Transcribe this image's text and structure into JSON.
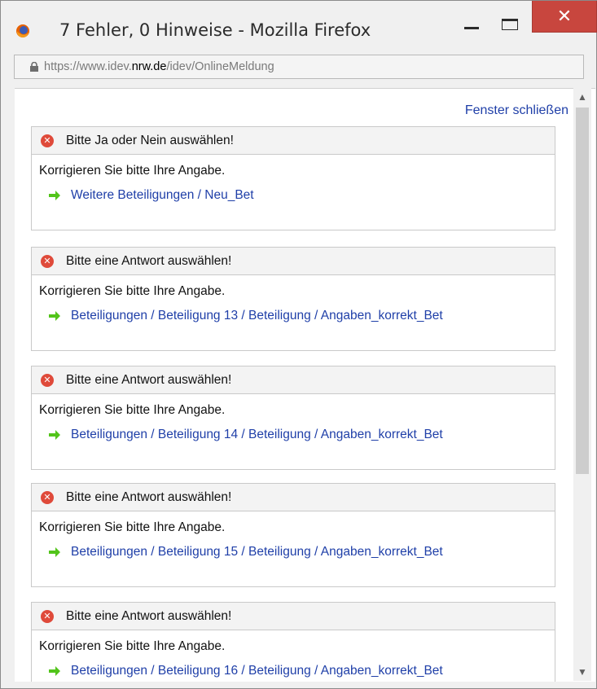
{
  "window": {
    "title": "7 Fehler, 0 Hinweise - Mozilla Firefox",
    "url_prefix": "https://www.idev.",
    "url_domain": "nrw.de",
    "url_suffix": "/idev/OnlineMeldung"
  },
  "page": {
    "close_link": "Fenster schließen"
  },
  "errors": [
    {
      "title": "Bitte Ja oder Nein auswählen!",
      "message": "Korrigieren Sie bitte Ihre Angabe.",
      "link": "Weitere Beteiligungen / Neu_Bet"
    },
    {
      "title": "Bitte eine Antwort auswählen!",
      "message": "Korrigieren Sie bitte Ihre Angabe.",
      "link": "Beteiligungen / Beteiligung 13 / Beteiligung / Angaben_korrekt_Bet"
    },
    {
      "title": "Bitte eine Antwort auswählen!",
      "message": "Korrigieren Sie bitte Ihre Angabe.",
      "link": "Beteiligungen / Beteiligung 14 / Beteiligung / Angaben_korrekt_Bet"
    },
    {
      "title": "Bitte eine Antwort auswählen!",
      "message": "Korrigieren Sie bitte Ihre Angabe.",
      "link": "Beteiligungen / Beteiligung 15 / Beteiligung / Angaben_korrekt_Bet"
    },
    {
      "title": "Bitte eine Antwort auswählen!",
      "message": "Korrigieren Sie bitte Ihre Angabe.",
      "link": "Beteiligungen / Beteiligung 16 / Beteiligung / Angaben_korrekt_Bet"
    }
  ],
  "colors": {
    "link": "#1f3fa8",
    "error_icon": "#df4a3a",
    "arrow": "#52c41a",
    "close_button": "#c8463e"
  },
  "icons": {
    "app": "firefox-icon",
    "lock": "lock-icon",
    "error": "error-circle-icon",
    "arrow": "green-arrow-icon"
  }
}
